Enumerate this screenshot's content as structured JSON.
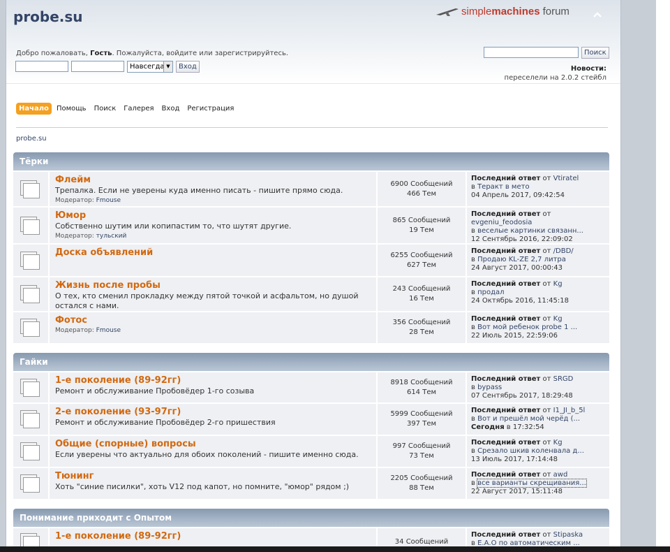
{
  "header": {
    "title": "probe.su",
    "logo": {
      "simple": "simple",
      "machines": "machines",
      "forum": "forum"
    },
    "collapse_icon": "chevron-up-icon",
    "greeting": {
      "prefix": "Добро пожаловать, ",
      "guest": "Гость",
      "suffix": ". Пожалуйста, войдите или зарегистрируйтесь."
    },
    "login": {
      "duration": "Навсегда",
      "submit": "Вход"
    },
    "search": {
      "button": "Поиск"
    },
    "news": {
      "label": "Новости:",
      "text": "переселели на 2.0.2 стейбл"
    }
  },
  "menu": [
    {
      "label": "Начало",
      "active": true
    },
    {
      "label": "Помощь"
    },
    {
      "label": "Поиск"
    },
    {
      "label": "Галерея"
    },
    {
      "label": "Вход"
    },
    {
      "label": "Регистрация"
    }
  ],
  "breadcrumb": "probe.su",
  "categories": [
    {
      "name": "Тёрки",
      "boards": [
        {
          "name": "Флейм",
          "desc": "Трепалка. Если не уверены куда именно писать - пишите прямо сюда.",
          "mod_label": "Модератор: ",
          "mod": "Fmouse",
          "posts": "6900 Сообщений",
          "topics": "466 Тем",
          "lp_label": "Последний ответ",
          "lp_by": " от ",
          "lp_user": "Vtiratel",
          "lp_in": "в ",
          "lp_topic": "Теракт в мето",
          "lp_date": "04 Апрель 2017, 09:42:54"
        },
        {
          "name": "Юмор",
          "desc": "Собственно шутим или копипастим то, что шутят другие.",
          "mod_label": "Модератор: ",
          "mod": "тульский",
          "posts": "865 Сообщений",
          "topics": "19 Тем",
          "lp_label": "Последний ответ",
          "lp_by": " от ",
          "lp_user": "evgeniu_feodosia",
          "lp_in": "в ",
          "lp_topic": "веселые картинки связанн...",
          "lp_date": "12 Сентябрь 2016, 22:09:02"
        },
        {
          "name": "Доска объявлений",
          "desc": "",
          "mod_label": "",
          "mod": "",
          "posts": "6255 Сообщений",
          "topics": "627 Тем",
          "lp_label": "Последний ответ",
          "lp_by": " от ",
          "lp_user": "/DBD/",
          "lp_in": "в ",
          "lp_topic": "Продаю KL-ZE 2,7 литра",
          "lp_date": "24 Август 2017, 00:00:43"
        },
        {
          "name": "Жизнь после пробы",
          "desc": "О тех, кто сменил прокладку между пятой точкой и асфальтом, но душой остался с нами.",
          "mod_label": "",
          "mod": "",
          "posts": "243 Сообщений",
          "topics": "16 Тем",
          "lp_label": "Последний ответ",
          "lp_by": " от ",
          "lp_user": "Kg",
          "lp_in": "в ",
          "lp_topic": "продал",
          "lp_date": "24 Октябрь 2016, 11:45:18"
        },
        {
          "name": "Фотос",
          "desc": "",
          "mod_label": "Модератор: ",
          "mod": "Fmouse",
          "posts": "356 Сообщений",
          "topics": "28 Тем",
          "lp_label": "Последний ответ",
          "lp_by": " от ",
          "lp_user": "Kg",
          "lp_in": "в ",
          "lp_topic": "Вот мой ребенок probe 1 ...",
          "lp_date": "22 Июль 2015, 22:59:06"
        }
      ]
    },
    {
      "name": "Гайки",
      "boards": [
        {
          "name": "1-е поколение (89-92гг)",
          "desc": "Ремонт и обслуживание Пробовёдер 1-го созыва",
          "mod_label": "",
          "mod": "",
          "posts": "8918 Сообщений",
          "topics": "614 Тем",
          "lp_label": "Последний ответ",
          "lp_by": " от ",
          "lp_user": "SRGD",
          "lp_in": "в ",
          "lp_topic": "bypass",
          "lp_date": "07 Сентябрь 2017, 18:29:48"
        },
        {
          "name": "2-е поколение (93-97гг)",
          "desc": "Ремонт и обслуживание Пробовёдер 2-го пришествия",
          "mod_label": "",
          "mod": "",
          "posts": "5999 Сообщений",
          "topics": "397 Тем",
          "lp_label": "Последний ответ",
          "lp_by": " от ",
          "lp_user": "I1_JI_b_5l",
          "lp_in": "в ",
          "lp_topic": "Вот и прешёл мой черёд (...",
          "lp_date_bold": "Сегодня",
          "lp_date": " в 17:32:54"
        },
        {
          "name": "Общие (спорные) вопросы",
          "desc": "Если уверены что актуально для обоих поколений - пишите именно сюда.",
          "mod_label": "",
          "mod": "",
          "posts": "997 Сообщений",
          "topics": "73 Тем",
          "lp_label": "Последний ответ",
          "lp_by": " от ",
          "lp_user": "Kg",
          "lp_in": "в ",
          "lp_topic": "Срезало шкив коленвала д...",
          "lp_date": "13 Июль 2017, 17:14:48"
        },
        {
          "name": "Тюнинг",
          "desc": "Хоть \"синие писилки\", хоть V12 под капот, но помните, \"юмор\" рядом ;)",
          "mod_label": "",
          "mod": "",
          "posts": "2205 Сообщений",
          "topics": "88 Тем",
          "lp_label": "Последний ответ",
          "lp_by": " от ",
          "lp_user": "awd",
          "lp_in": "в ",
          "lp_topic": "все варианты скрещивания...",
          "lp_date": "22 Август 2017, 15:11:48",
          "focused": true
        }
      ]
    },
    {
      "name": "Понимание приходит с Опытом",
      "boards": [
        {
          "name": "1-е поколение (89-92гг)",
          "desc": "",
          "mod_label": "",
          "mod": "",
          "posts": "34 Сообщений",
          "topics": "",
          "lp_label": "Последний ответ",
          "lp_by": " от ",
          "lp_user": "Stipaska",
          "lp_in": "в ",
          "lp_topic": "Е.А.О по автоматическим ...",
          "lp_date": ""
        }
      ]
    }
  ]
}
